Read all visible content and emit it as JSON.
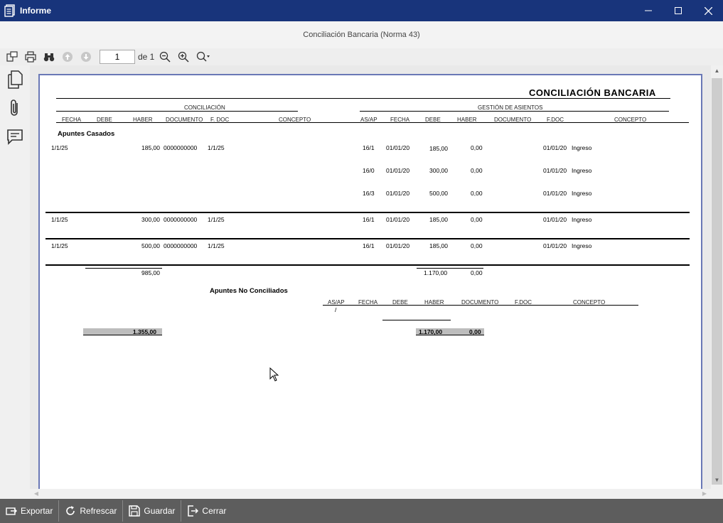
{
  "window": {
    "title": "Informe"
  },
  "subtitle": "Conciliación Bancaria (Norma 43)",
  "toolbar": {
    "page_value": "1",
    "page_of": "de 1"
  },
  "report": {
    "title": "CONCILIACIÓN BANCARIA",
    "section_conciliacion": "CONCILIACIÓN",
    "section_gestion": "GESTIÓN DE ASIENTOS",
    "headers_left": [
      "FECHA",
      "DEBE",
      "HABER",
      "DOCUMENTO",
      "F. DOC",
      "CONCEPTO"
    ],
    "headers_right": [
      "AS/AP",
      "FECHA",
      "DEBE",
      "HABER",
      "DOCUMENTO",
      "F.DOC",
      "CONCEPTO"
    ],
    "group_casados": "Apuntes Casados",
    "casados": [
      {
        "left": {
          "fecha": "1/1/25",
          "haber": "185,00",
          "documento": "0000000000",
          "fdoc": "1/1/25"
        },
        "right": [
          {
            "asap": "16/1",
            "fecha": "01/01/20",
            "debe": "185,00",
            "haber": "0,00",
            "fdoc": "01/01/20",
            "concepto": "Ingreso"
          },
          {
            "asap": "16/0",
            "fecha": "01/01/20",
            "debe": "300,00",
            "haber": "0,00",
            "fdoc": "01/01/20",
            "concepto": "Ingreso"
          },
          {
            "asap": "16/3",
            "fecha": "01/01/20",
            "debe": "500,00",
            "haber": "0,00",
            "fdoc": "01/01/20",
            "concepto": "Ingreso"
          }
        ]
      },
      {
        "left": {
          "fecha": "1/1/25",
          "haber": "300,00",
          "documento": "0000000000",
          "fdoc": "1/1/25"
        },
        "right": [
          {
            "asap": "16/1",
            "fecha": "01/01/20",
            "debe": "185,00",
            "haber": "0,00",
            "fdoc": "01/01/20",
            "concepto": "Ingreso"
          }
        ]
      },
      {
        "left": {
          "fecha": "1/1/25",
          "haber": "500,00",
          "documento": "0000000000",
          "fdoc": "1/1/25"
        },
        "right": [
          {
            "asap": "16/1",
            "fecha": "01/01/20",
            "debe": "185,00",
            "haber": "0,00",
            "fdoc": "01/01/20",
            "concepto": "Ingreso"
          }
        ]
      }
    ],
    "subtotal": {
      "haber_left": "985,00",
      "debe_right": "1.170,00",
      "haber_right": "0,00"
    },
    "group_no_conciliados": "Apuntes No Conciliados",
    "headers_nc": [
      "AS/AP",
      "FECHA",
      "DEBE",
      "HABER",
      "DOCUMENTO",
      "F.DOC",
      "CONCEPTO"
    ],
    "nc_slash": "/",
    "total": {
      "left": "1.355,00",
      "debe_right": "1.170,00",
      "haber_right": "0,00"
    }
  },
  "bottom": {
    "exportar": "Exportar",
    "refrescar": "Refrescar",
    "guardar": "Guardar",
    "cerrar": "Cerrar"
  }
}
